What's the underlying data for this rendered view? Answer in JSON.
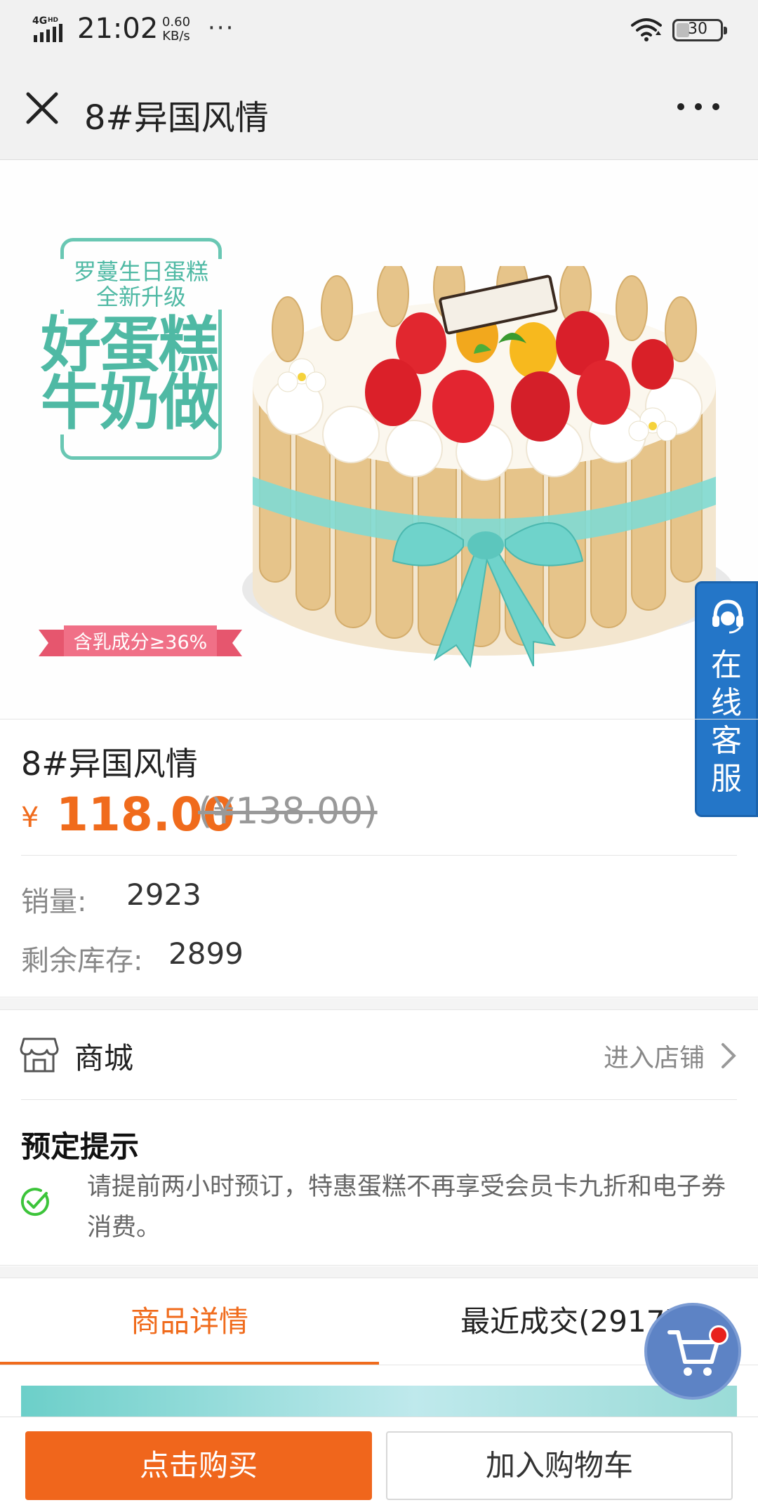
{
  "status_bar": {
    "network": "4G HD",
    "time": "21:02",
    "speed_value": "0.60",
    "speed_unit": "KB/s",
    "more": "···",
    "battery": "30",
    "battery_level": 0.3
  },
  "title_bar": {
    "title": "8#异国风情",
    "close_icon": "close-icon",
    "more_icon": "more-dots-icon"
  },
  "banner": {
    "promo_subtitle_line1": "罗蔓生日蛋糕",
    "promo_subtitle_line2": "全新升级",
    "promo_headline_line1": "好蛋糕",
    "promo_headline_line2": "牛奶做",
    "milk_badge": "含乳成分≥36%",
    "slide_count": 1,
    "active_slide": 1,
    "accent_color": "#4fb9a4"
  },
  "service_tab": {
    "label": "在线客服",
    "icon": "headset-icon",
    "color": "#2476c8"
  },
  "product": {
    "name": "8#异国风情",
    "currency": "¥",
    "price": "118.00",
    "original_price": "(¥138.00)",
    "price_color": "#f06b1c"
  },
  "stats": {
    "sales_label": "销量:",
    "sales_value": "2923",
    "stock_label": "剩余库存:",
    "stock_value": "2899"
  },
  "shop": {
    "name": "商城",
    "icon": "store-icon",
    "link": "进入店铺"
  },
  "notice": {
    "title": "预定提示",
    "text": "请提前两小时预订，特惠蛋糕不再享受会员卡九折和电子券消费。",
    "icon": "check-circle-icon"
  },
  "tabs": [
    {
      "label": "商品详情",
      "active": true
    },
    {
      "label": "最近成交(2917)",
      "active": false
    }
  ],
  "floating_cart": {
    "icon": "cart-icon",
    "has_badge": true
  },
  "bottom_bar": {
    "buy_label": "点击购买",
    "add_cart_label": "加入购物车"
  }
}
